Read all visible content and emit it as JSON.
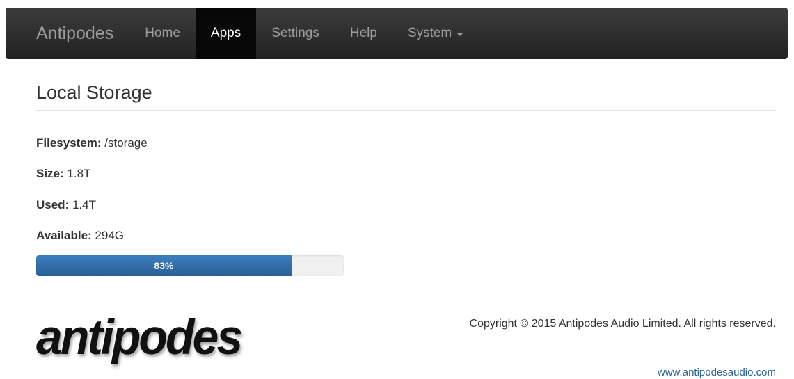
{
  "navbar": {
    "brand": "Antipodes",
    "items": [
      {
        "label": "Home",
        "active": false
      },
      {
        "label": "Apps",
        "active": true
      },
      {
        "label": "Settings",
        "active": false
      },
      {
        "label": "Help",
        "active": false
      },
      {
        "label": "System",
        "active": false,
        "dropdown": true
      }
    ]
  },
  "page": {
    "title": "Local Storage",
    "filesystem_label": "Filesystem:",
    "filesystem_value": "/storage",
    "size_label": "Size:",
    "size_value": "1.8T",
    "used_label": "Used:",
    "used_value": "1.4T",
    "available_label": "Available:",
    "available_value": "294G",
    "usage_percent": 83,
    "usage_label": "83%"
  },
  "footer": {
    "logo_text": "antipodes",
    "copyright": "Copyright © 2015 Antipodes Audio Limited. All rights reserved.",
    "website": "www.antipodesaudio.com"
  },
  "colors": {
    "navbar_bg": "#222222",
    "progress_fill": "#2f6ea8",
    "link": "#2a6496"
  }
}
